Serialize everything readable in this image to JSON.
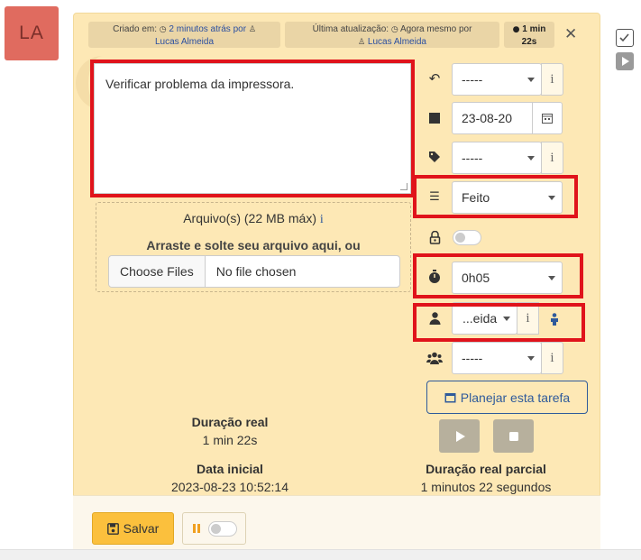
{
  "avatar": {
    "initials": "LA"
  },
  "header": {
    "created_label": "Criado em:",
    "created_time": "2 minutos atrás por",
    "created_user": "Lucas Almeida",
    "updated_label": "Última atualização:",
    "updated_time": "Agora mesmo por",
    "updated_user": "Lucas Almeida",
    "duration_badge": "1 min 22s"
  },
  "task": {
    "description": "Verificar problema da impressora."
  },
  "upload": {
    "title": "Arquivo(s) (22 MB máx)",
    "drop_text": "Arraste e solte seu arquivo aqui, ou",
    "choose_files": "Choose Files",
    "no_file": "No file chosen"
  },
  "fields": {
    "undo_select": "-----",
    "date": "23-08-20",
    "tag_select": "-----",
    "status_select": "Feito",
    "estimate_select": "0h05",
    "assignee_select": "...eida",
    "group_select": "-----"
  },
  "actions": {
    "plan_task": "Planejar esta tarefa",
    "save": "Salvar"
  },
  "stats": {
    "real_duration_label": "Duração real",
    "real_duration_value": "1 min 22s",
    "start_date_label": "Data inicial",
    "start_date_value": "2023-08-23 10:52:14",
    "partial_duration_label": "Duração real parcial",
    "partial_duration_value": "1 minutos 22 segundos"
  },
  "colors": {
    "card_bg": "#fde8b5",
    "highlight_red": "#e0131b",
    "save_yellow": "#fbc03d",
    "link_blue": "#2f5a9b"
  }
}
